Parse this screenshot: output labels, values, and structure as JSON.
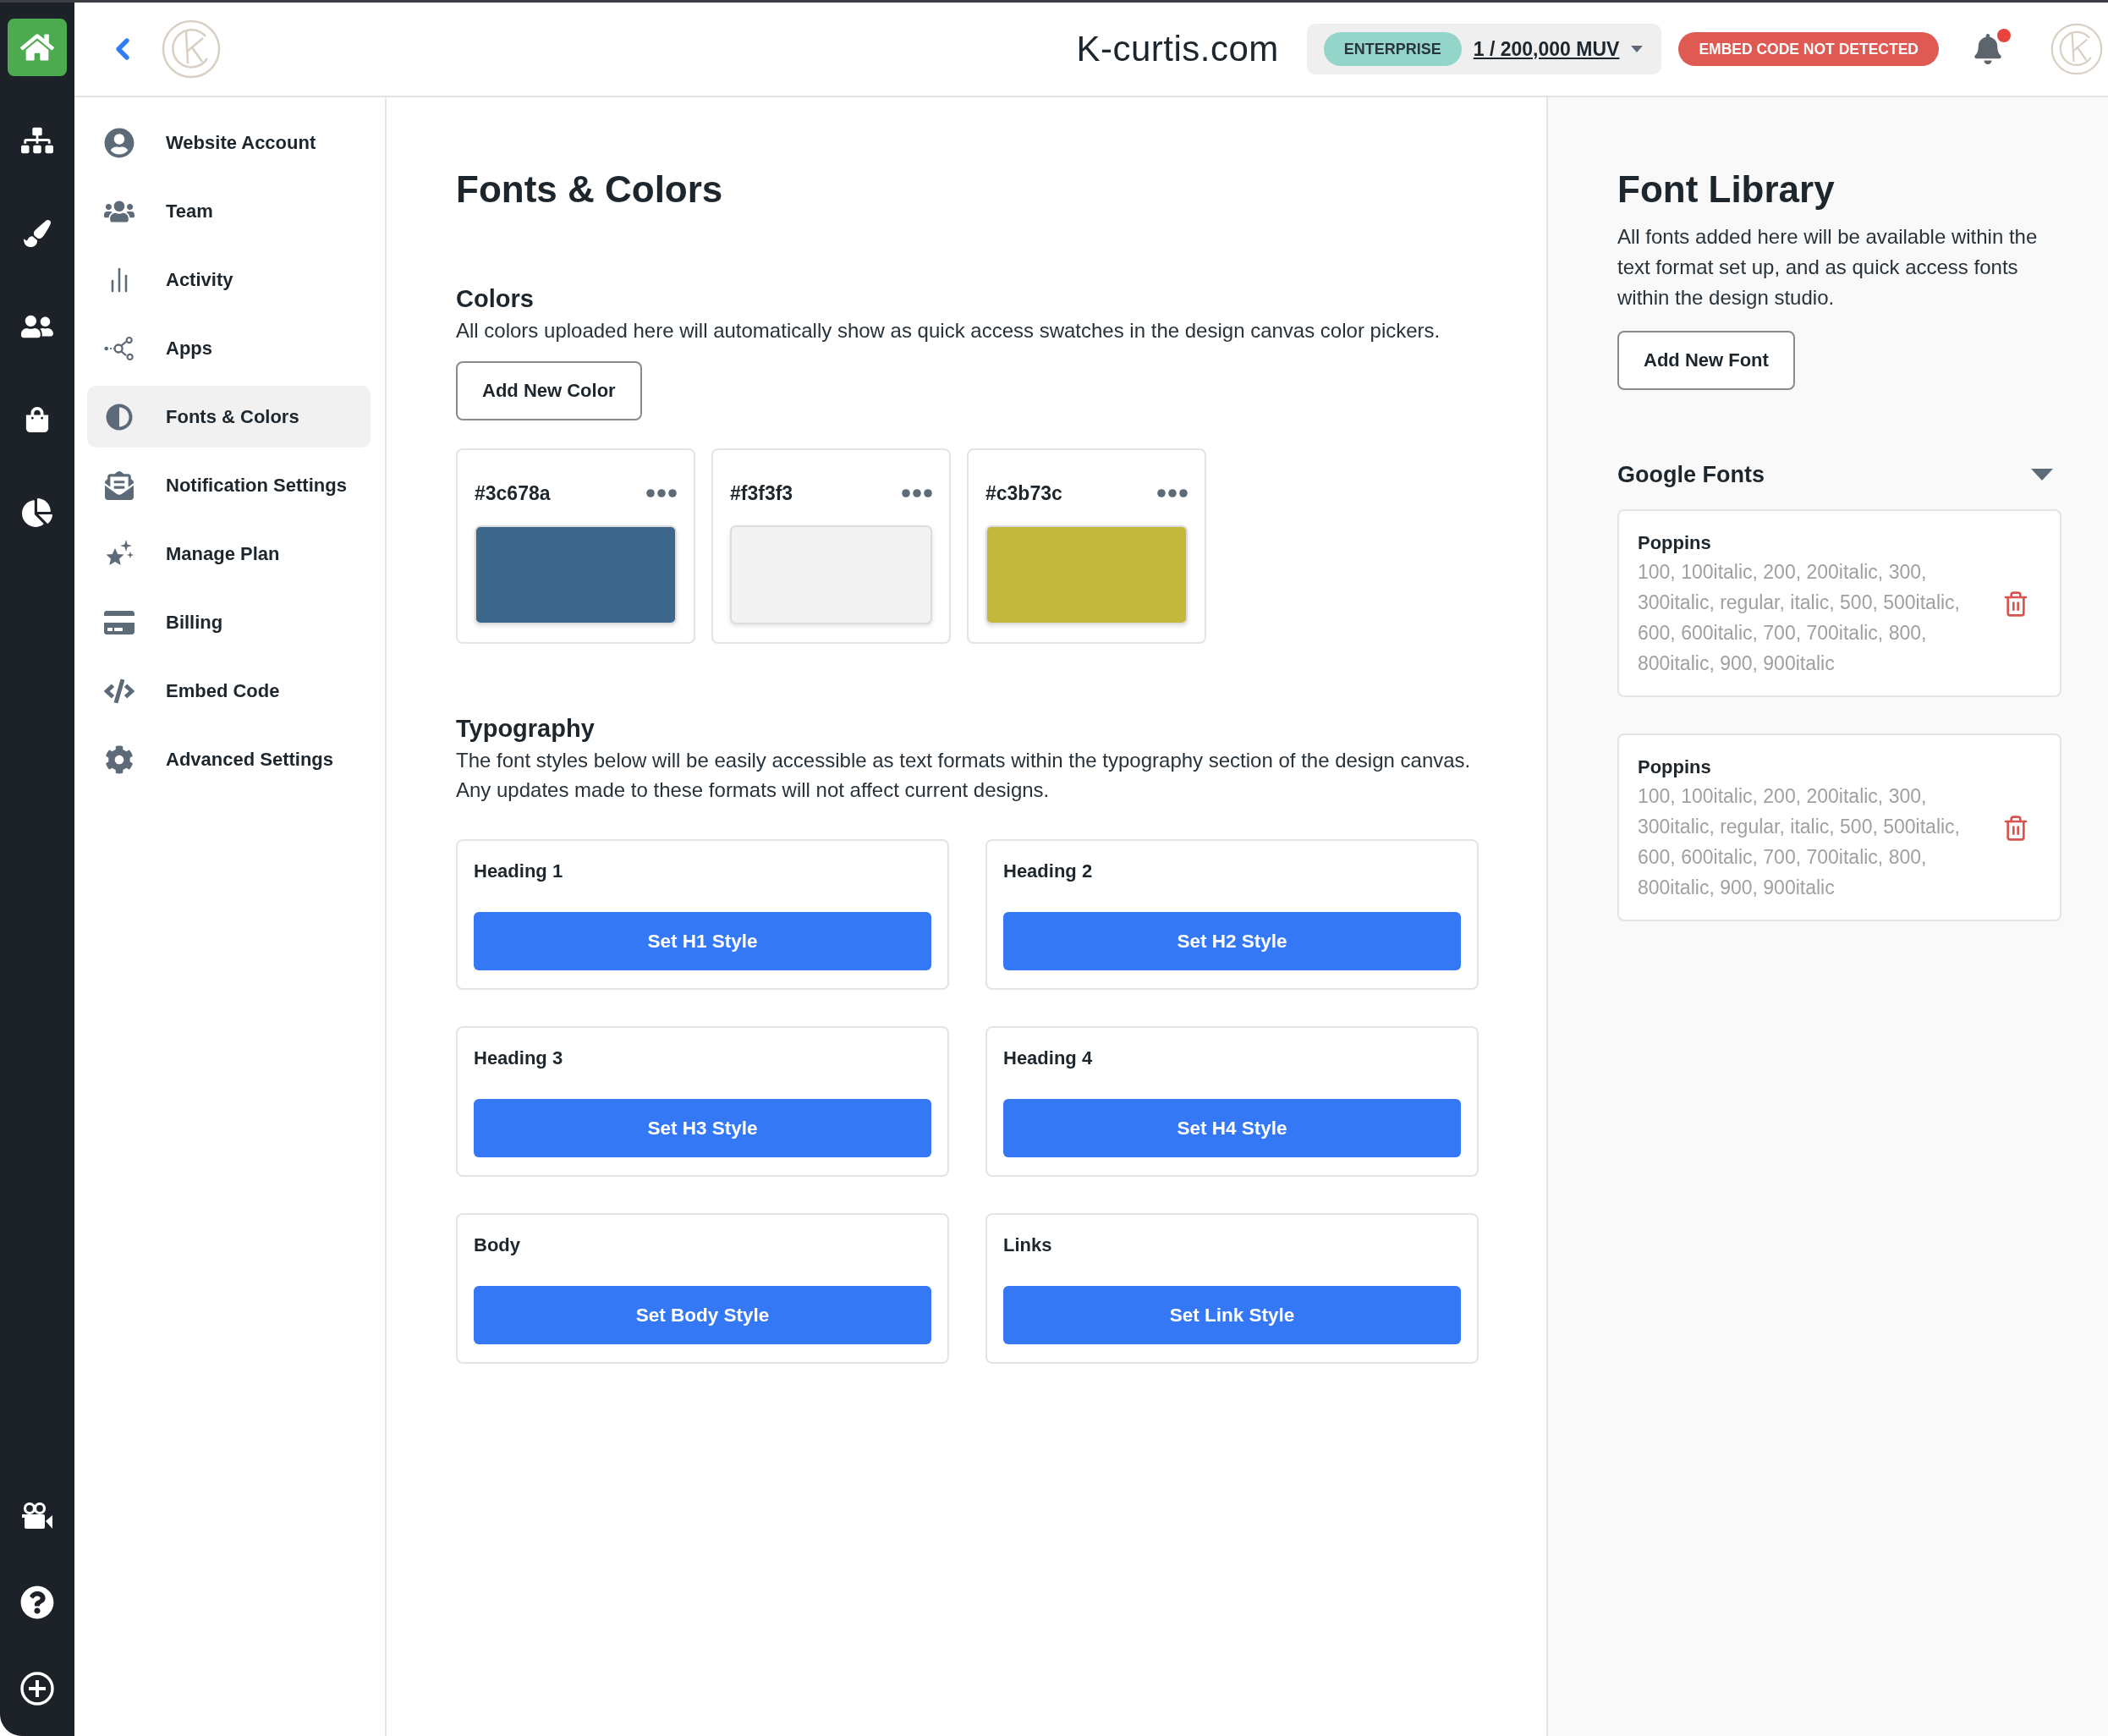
{
  "rail": {
    "items": [
      {
        "selected": true
      },
      {
        "selected": false
      },
      {
        "selected": false
      },
      {
        "selected": false
      },
      {
        "selected": false
      },
      {
        "selected": false
      }
    ]
  },
  "header": {
    "site_name": "K-curtis.com",
    "plan": {
      "tier": "ENTERPRISE",
      "usage": "1 / 200,000 MUV"
    },
    "embed_status": "EMBED CODE NOT DETECTED",
    "notifications": {
      "unread": true
    }
  },
  "sidebar": {
    "items": [
      {
        "label": "Website Account",
        "selected": false
      },
      {
        "label": "Team",
        "selected": false
      },
      {
        "label": "Activity",
        "selected": false
      },
      {
        "label": "Apps",
        "selected": false
      },
      {
        "label": "Fonts & Colors",
        "selected": true
      },
      {
        "label": "Notification Settings",
        "selected": false
      },
      {
        "label": "Manage Plan",
        "selected": false
      },
      {
        "label": "Billing",
        "selected": false
      },
      {
        "label": "Embed Code",
        "selected": false
      },
      {
        "label": "Advanced Settings",
        "selected": false
      }
    ]
  },
  "main": {
    "title": "Fonts & Colors",
    "colors": {
      "heading": "Colors",
      "description": "All colors uploaded here will automatically show as quick access swatches in the design canvas color pickers.",
      "add_button": "Add New Color",
      "swatches": [
        {
          "label": "#3c678a",
          "color": "#3c678a"
        },
        {
          "label": "#f3f3f3",
          "color": "#f3f3f3"
        },
        {
          "label": "#c3b73c",
          "color": "#c3b73c"
        }
      ]
    },
    "typography": {
      "heading": "Typography",
      "description": "The font styles below will be easily accessible as text formats within the typography section of the design canvas. Any updates made to these formats will not affect current designs.",
      "styles": [
        {
          "name": "Heading 1",
          "button": "Set H1 Style"
        },
        {
          "name": "Heading 2",
          "button": "Set H2 Style"
        },
        {
          "name": "Heading 3",
          "button": "Set H3 Style"
        },
        {
          "name": "Heading 4",
          "button": "Set H4 Style"
        },
        {
          "name": "Body",
          "button": "Set Body Style"
        },
        {
          "name": "Links",
          "button": "Set Link Style"
        }
      ]
    }
  },
  "font_library": {
    "title": "Font Library",
    "description": "All fonts added here will be available within the text format set up, and as quick access fonts within the design studio.",
    "add_button": "Add New Font",
    "google_fonts": {
      "heading": "Google Fonts",
      "expanded": true,
      "fonts": [
        {
          "name": "Poppins",
          "variants": "100, 100italic, 200, 200italic, 300, 300italic, regular, italic, 500, 500italic, 600, 600italic, 700, 700italic, 800, 800italic, 900, 900italic"
        },
        {
          "name": "Poppins",
          "variants": "100, 100italic, 200, 200italic, 300, 300italic, regular, italic, 500, 500italic, 600, 600italic, 700, 700italic, 800, 800italic, 900, 900italic"
        }
      ]
    }
  }
}
